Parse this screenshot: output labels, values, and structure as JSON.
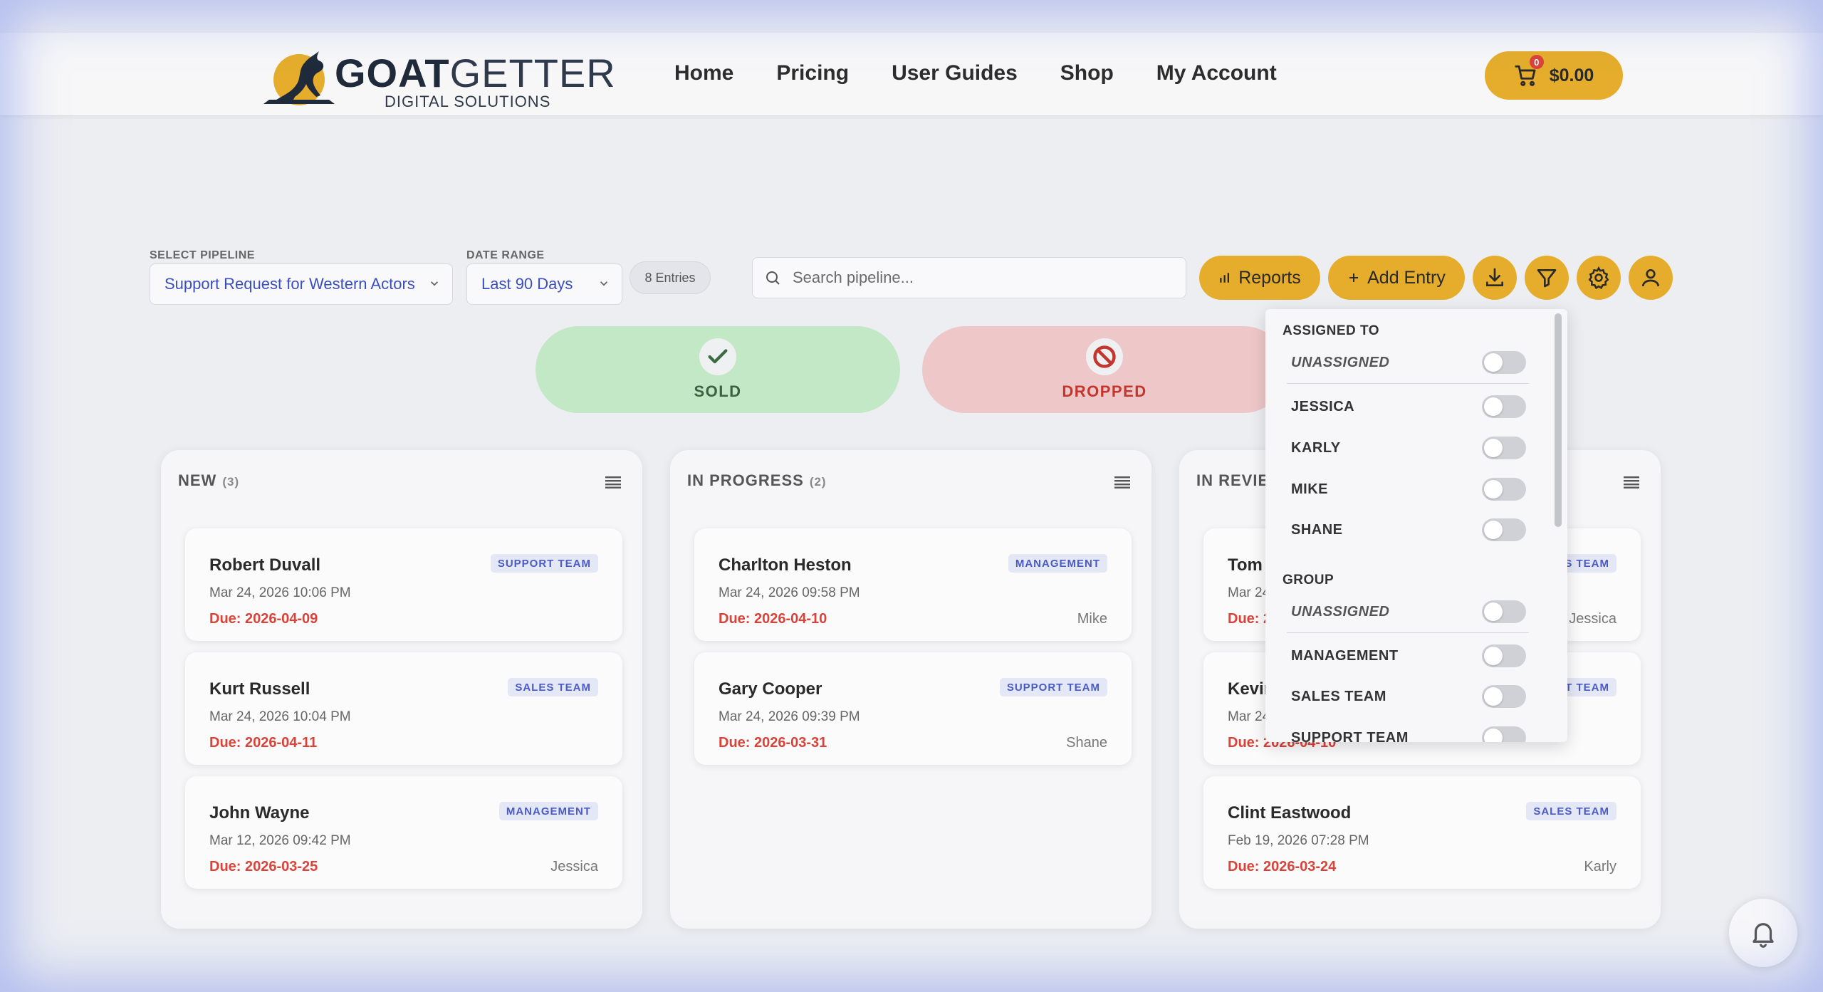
{
  "brand": {
    "name_bold": "GOAT",
    "name_light": "GETTER",
    "subtitle": "DIGITAL SOLUTIONS"
  },
  "nav": [
    {
      "label": "Home"
    },
    {
      "label": "Pricing"
    },
    {
      "label": "User Guides"
    },
    {
      "label": "Shop"
    },
    {
      "label": "My Account"
    }
  ],
  "cart": {
    "count": "0",
    "total": "$0.00",
    "icon": "cart-icon"
  },
  "toolbar": {
    "pipeline_label": "SELECT PIPELINE",
    "pipeline_value": "Support Request for Western Actors",
    "date_label": "DATE RANGE",
    "date_value": "Last 90 Days",
    "entries": "8 Entries",
    "search_placeholder": "Search pipeline...",
    "reports_label": "Reports",
    "add_entry_label": "Add Entry"
  },
  "zones": {
    "sold": "SOLD",
    "dropped": "DROPPED"
  },
  "columns": [
    {
      "title": "NEW",
      "count": "(3)",
      "cards": [
        {
          "name": "Robert Duvall",
          "tag": "SUPPORT TEAM",
          "date": "Mar 24, 2026 10:06 PM",
          "due": "Due: 2026-04-09",
          "assignee": ""
        },
        {
          "name": "Kurt Russell",
          "tag": "SALES TEAM",
          "date": "Mar 24, 2026 10:04 PM",
          "due": "Due: 2026-04-11",
          "assignee": ""
        },
        {
          "name": "John Wayne",
          "tag": "MANAGEMENT",
          "date": "Mar 12, 2026 09:42 PM",
          "due": "Due: 2026-03-25",
          "assignee": "Jessica"
        }
      ]
    },
    {
      "title": "IN PROGRESS",
      "count": "(2)",
      "cards": [
        {
          "name": "Charlton Heston",
          "tag": "MANAGEMENT",
          "date": "Mar 24, 2026 09:58 PM",
          "due": "Due: 2026-04-10",
          "assignee": "Mike"
        },
        {
          "name": "Gary Cooper",
          "tag": "SUPPORT TEAM",
          "date": "Mar 24, 2026 09:39 PM",
          "due": "Due: 2026-03-31",
          "assignee": "Shane"
        }
      ]
    },
    {
      "title": "IN REVIE",
      "count": "",
      "cards": [
        {
          "name": "Tom",
          "tag": "S TEAM",
          "date": "Mar 24",
          "due": "Due: 2",
          "assignee": "Jessica"
        },
        {
          "name": "Kevir",
          "tag": "T TEAM",
          "date": "Mar 24",
          "due": "Due: 2026-04-10",
          "assignee": ""
        },
        {
          "name": "Clint Eastwood",
          "tag": "SALES TEAM",
          "date": "Feb 19, 2026 07:28 PM",
          "due": "Due: 2026-03-24",
          "assignee": "Karly"
        }
      ]
    }
  ],
  "filter": {
    "assigned_heading": "ASSIGNED TO",
    "assigned": [
      "UNASSIGNED",
      "JESSICA",
      "KARLY",
      "MIKE",
      "SHANE"
    ],
    "group_heading": "GROUP",
    "groups": [
      "UNASSIGNED",
      "MANAGEMENT",
      "SALES TEAM",
      "SUPPORT TEAM"
    ]
  },
  "colors": {
    "accent": "#e5ad2b",
    "due": "#d9433a",
    "sold_bg": "#c2e8c6",
    "dropped_bg": "#eec8c8",
    "tag_text": "#4a5bc2"
  }
}
